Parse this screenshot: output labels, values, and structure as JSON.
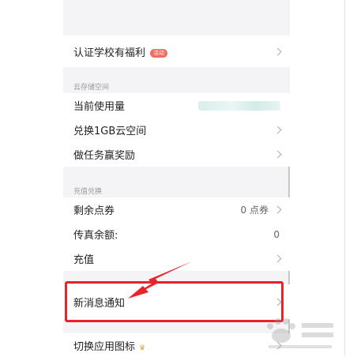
{
  "rows": {
    "school_benefit": {
      "label": "认证学校有福利",
      "badge": "活动"
    },
    "current_usage": {
      "label": "当前使用量"
    },
    "redeem_space": {
      "label": "兑换1GB云空间"
    },
    "task_reward": {
      "label": "做任务赢奖励"
    },
    "remaining_points": {
      "label": "剩余点券",
      "value": "0 点券"
    },
    "fax_balance": {
      "label": "传真余额:",
      "value": "0"
    },
    "recharge": {
      "label": "充值"
    },
    "new_message_notify": {
      "label": "新消息通知"
    },
    "switch_app_icon": {
      "label": "切换应用图标"
    }
  },
  "sections": {
    "cloud_storage": "云存储空间",
    "recharge_redeem": "充值兑换"
  },
  "colors": {
    "highlight": "#e8232a",
    "badge": "#f06b62",
    "crown": "#d9a93c"
  },
  "icons": {
    "chevron": "chevron-right-icon",
    "crown": "crown-icon",
    "arrow": "red-pointer-arrow"
  }
}
